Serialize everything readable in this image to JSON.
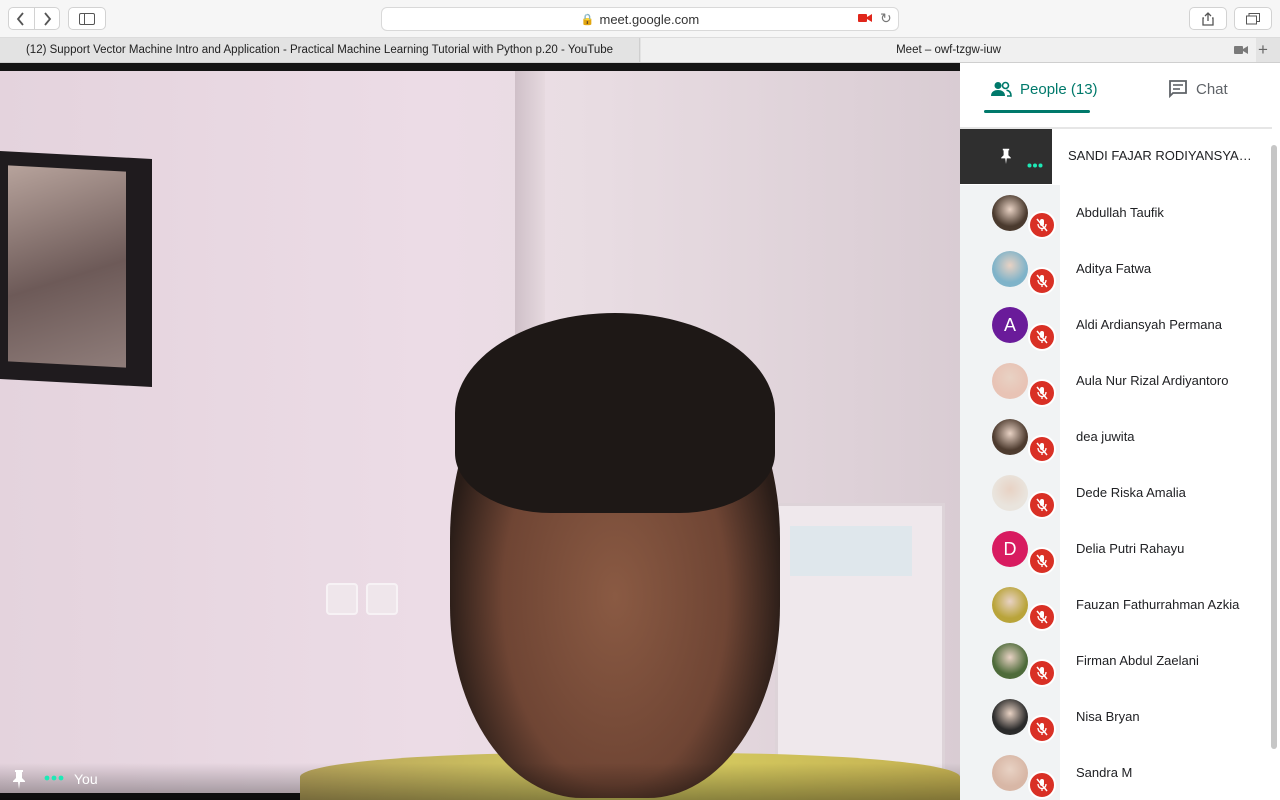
{
  "browser": {
    "url": "meet.google.com",
    "tabs": [
      {
        "label": "(12) Support Vector Machine Intro and Application - Practical Machine Learning Tutorial with Python p.20 - YouTube"
      },
      {
        "label": "Meet – owf-tzgw-iuw"
      }
    ]
  },
  "video": {
    "self_label": "You"
  },
  "panel": {
    "people_tab": "People (13)",
    "chat_tab": "Chat",
    "pinned_name": "SANDI FAJAR RODIYANSYAH (...",
    "participants": [
      {
        "name": "Abdullah Taufik",
        "avatar": "photo",
        "color": "#4a3a2e"
      },
      {
        "name": "Aditya Fatwa",
        "avatar": "photo",
        "color": "#7fb3c9"
      },
      {
        "name": "Aldi Ardiansyah Permana",
        "avatar": "A",
        "color": "#6a1b9a"
      },
      {
        "name": "Aula Nur Rizal Ardiyantoro",
        "avatar": "photo",
        "color": "#e8c3b5"
      },
      {
        "name": "dea juwita",
        "avatar": "photo",
        "color": "#4d3b2f"
      },
      {
        "name": "Dede Riska Amalia",
        "avatar": "photo",
        "color": "#e9e4dd"
      },
      {
        "name": "Delia Putri Rahayu",
        "avatar": "D",
        "color": "#d81b60"
      },
      {
        "name": "Fauzan Fathurrahman Azkia",
        "avatar": "photo",
        "color": "#b9a43a"
      },
      {
        "name": "Firman Abdul Zaelani",
        "avatar": "photo",
        "color": "#4e6b3a"
      },
      {
        "name": "Nisa Bryan",
        "avatar": "photo",
        "color": "#2b2b2b"
      },
      {
        "name": "Sandra M",
        "avatar": "photo",
        "color": "#d8b7a6"
      }
    ]
  },
  "colors": {
    "accent": "#00796b",
    "mute": "#d93025",
    "dots": "#1de9b6"
  }
}
